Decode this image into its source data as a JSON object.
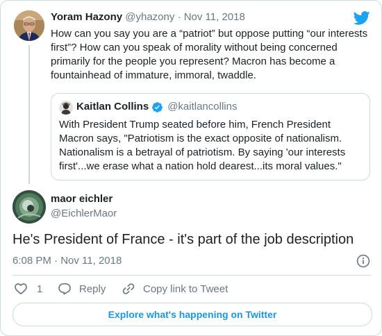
{
  "parent_tweet": {
    "author_name": "Yoram Hazony",
    "author_handle": "@yhazony",
    "separator": "·",
    "date": "Nov 11, 2018",
    "text": "How can you say you are a “patriot” but oppose putting “our interests\nfirst”? How can you speak of morality without being concerned\nprimarily for the people you represent? Macron has become a\nfountainhead of immature, immoral, twaddle."
  },
  "quoted_tweet": {
    "author_name": "Kaitlan Collins",
    "author_handle": "@kaitlancollins",
    "verified": true,
    "text": "With President Trump seated before him, French President\nMacron says, \"Patriotism is the exact opposite of nationalism.\nNationalism is a betrayal of patriotism. By saying 'our interests\nfirst'...we erase what a nation hold dearest...its moral values.\""
  },
  "main_tweet": {
    "author_name": "maor eichler",
    "author_handle": "@EichlerMaor",
    "text": "He's President of France - it's part of the job description",
    "timestamp": "6:08 PM · Nov 11, 2018"
  },
  "actions": {
    "like_count": "1",
    "reply_label": "Reply",
    "copy_link_label": "Copy link to Tweet"
  },
  "explore_button": "Explore what's happening on Twitter",
  "icons": {
    "brand": "twitter-bird-icon",
    "verified": "verified-badge-icon",
    "info": "info-icon",
    "like": "heart-icon",
    "reply": "reply-bubble-icon",
    "copy": "link-icon"
  },
  "colors": {
    "twitter_blue": "#1da1f2",
    "link_blue": "#1b95e0",
    "text": "#1c2022",
    "muted": "#697882",
    "border": "#cfd9de"
  }
}
